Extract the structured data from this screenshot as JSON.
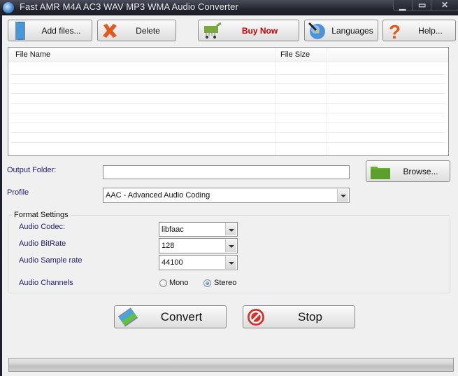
{
  "window": {
    "title": "Fast AMR M4A AC3 WAV MP3 WMA Audio Converter",
    "controls": {
      "minimize_icon": "minimize-icon",
      "maximize_icon": "maximize-icon",
      "close_icon": "close-icon"
    }
  },
  "toolbar": {
    "add_files": {
      "label": "Add files...",
      "icon": "film-strip-icon"
    },
    "delete": {
      "label": "Delete",
      "icon": "red-x-icon"
    },
    "buy_now": {
      "label": "Buy Now",
      "icon": "shopping-cart-icon",
      "color": "#cc0000"
    },
    "languages": {
      "label": "Languages",
      "icon": "globe-pen-icon"
    },
    "help": {
      "label": "Help...",
      "icon": "question-mark-icon"
    }
  },
  "file_list": {
    "columns": [
      "File Name",
      "File Size"
    ],
    "rows": []
  },
  "output": {
    "label": "Output Folder:",
    "value": "",
    "browse_label": "Browse...",
    "browse_icon": "folder-icon"
  },
  "profile": {
    "label": "Profile",
    "selected": "AAC - Advanced Audio Coding"
  },
  "format_settings": {
    "title": "Format Settings",
    "audio_codec": {
      "label": "Audio Codec:",
      "selected": "libfaac"
    },
    "audio_bitrate": {
      "label": "Audio BitRate",
      "selected": "128"
    },
    "audio_sample_rate": {
      "label": "Audio Sample rate",
      "selected": "44100"
    },
    "audio_channels": {
      "label": "Audio Channels",
      "options": [
        {
          "label": "Mono",
          "checked": false
        },
        {
          "label": "Stereo",
          "checked": true
        }
      ]
    }
  },
  "actions": {
    "convert": {
      "label": "Convert",
      "icon": "film-convert-icon"
    },
    "stop": {
      "label": "Stop",
      "icon": "stop-sign-icon"
    }
  },
  "progress": {
    "value_percent": 0
  }
}
